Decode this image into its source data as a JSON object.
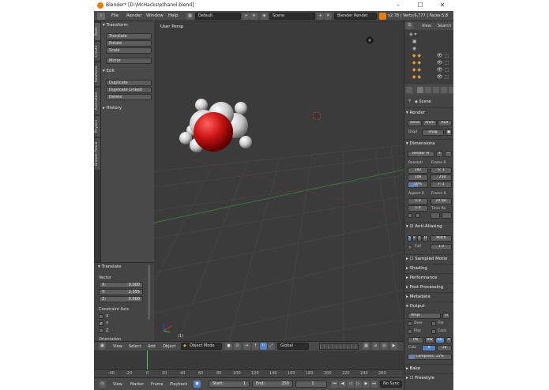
{
  "window": {
    "title": "Blender* [D:\\McHacks\\ethanol.blend]",
    "minimize": "–",
    "maximize": "☐",
    "close": "✕"
  },
  "info_header": {
    "menus": [
      "File",
      "Render",
      "Window",
      "Help"
    ],
    "layout": "Default",
    "scene": "Scene",
    "engine": "Blender Render",
    "stats": "v2.78 | Verts:6,777 | Faces:5,8"
  },
  "tabs": [
    "Tools",
    "Create",
    "Relations",
    "Animation",
    "Physics",
    "Grease Pencil"
  ],
  "toolshelf": {
    "transform_header": "Transform",
    "transform_buttons": [
      "Translate",
      "Rotate",
      "Scale",
      "Mirror"
    ],
    "edit_header": "Edit",
    "edit_buttons": [
      "Duplicate",
      "Duplicate Linked",
      "Delete"
    ],
    "history_header": "History"
  },
  "operator": {
    "header": "Translate",
    "vector_label": "Vector",
    "x": {
      "k": "X:",
      "v": "0.000"
    },
    "y": {
      "k": "Y:",
      "v": "2.355"
    },
    "z": {
      "k": "Z:",
      "v": "0.000"
    },
    "constraint_label": "Constraint Axis",
    "axes": [
      "X",
      "Y",
      "Z"
    ],
    "orientation_label": "Orientation"
  },
  "viewport": {
    "label": "User Persp",
    "frame_indicator": "(1)"
  },
  "view3d_header": {
    "menus": [
      "View",
      "Select",
      "Add",
      "Object"
    ],
    "mode": "Object Mode",
    "orientation": "Global"
  },
  "timeline": {
    "ticks": [
      "-40",
      "-20",
      "0",
      "20",
      "40",
      "60",
      "80",
      "100",
      "120",
      "140",
      "160",
      "180",
      "200",
      "220",
      "240",
      "260"
    ],
    "menus": [
      "View",
      "Marker",
      "Frame",
      "Playback"
    ],
    "start_label": "Start:",
    "start_value": "1",
    "end_label": "End:",
    "end_value": "250",
    "current_frame": "1",
    "sync": "No Sync"
  },
  "outliner": {
    "menus": [
      "View",
      "Search"
    ]
  },
  "properties": {
    "scene_label": "Scene",
    "render_header": "Render",
    "render_buttons": [
      "Rend",
      "Anim",
      "Aud"
    ],
    "display_label": "Displ",
    "display_value": "Imag",
    "dimensions_header": "Dimensions",
    "preset": "Render Pr",
    "resolution_label": "Resoluti",
    "frame_range_label": "Frame R",
    "res_x": "192",
    "res_y": "108",
    "res_pct": "50%",
    "start_short": "S: 1",
    "end_short": ": 250",
    "step_short": "F: 1",
    "aspect_label": "Aspect R",
    "frame_rate_label": "Frame R",
    "aspect_x": "1.0",
    "aspect_y": "1.0",
    "fps": "24 fps",
    "time_label": "Time Re",
    "time_a": "",
    "aa_header": "Anti-Aliasing",
    "aa_samples": [
      "5",
      "8",
      "11",
      "16"
    ],
    "aa_filter": "Mitch",
    "full_label": "Full",
    "full_value": "1.0",
    "sampled_header": "Sampled Motio",
    "shading_header": "Shading",
    "performance_header": "Performance",
    "post_header": "Post Processing",
    "metadata_header": "Metadata",
    "output_header": "Output",
    "output_path": "/tmp\\",
    "overwrite_label": "Over",
    "file_label": "File",
    "placeholders_label": "Plac",
    "cache_label": "Cach",
    "format": "PN",
    "color_bw": "BW",
    "color_rgb": "RG",
    "color_depth_label": "Colo",
    "depth_8": "8",
    "depth_16": "16",
    "compression": "Compress: 15%",
    "bake_header": "Bake",
    "freestyle_header": "Freestyle"
  }
}
